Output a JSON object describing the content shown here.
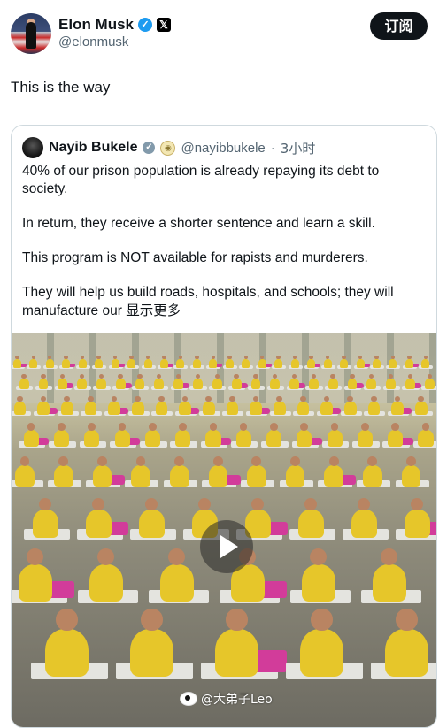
{
  "post": {
    "author_name": "Elon Musk",
    "author_handle": "@elonmusk",
    "subscribe_label": "订阅",
    "text": "This is the way"
  },
  "quote": {
    "author_name": "Nayib Bukele",
    "author_handle": "@nayibbukele",
    "separator": "·",
    "time": "3小时",
    "paragraphs": [
      "40% of our prison population is already repaying its debt to society.",
      "In return, they receive a shorter sentence and learn a skill.",
      "This program is NOT available for rapists and murderers."
    ],
    "last_paragraph": "They will help us build roads, hospitals, and schools; they will manufacture our ",
    "show_more": "显示更多"
  },
  "media": {
    "type": "video",
    "play_icon": "play-icon"
  },
  "watermark": {
    "text": "@大弟子Leo",
    "icon": "weibo-icon"
  },
  "colors": {
    "verified_blue": "#1d9bf0",
    "verified_gray": "#829aab",
    "subscribe_bg": "#0f1419",
    "uniform_yellow": "#e6c62a",
    "fabric_pink": "#d23c9a"
  }
}
